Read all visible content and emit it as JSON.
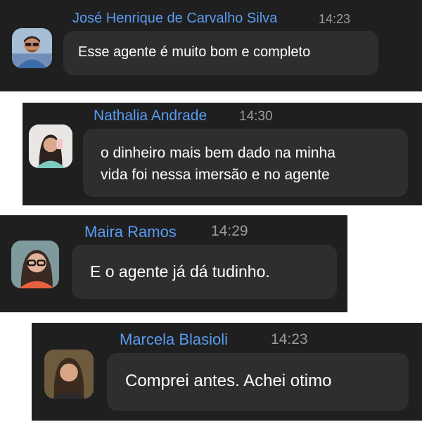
{
  "messages": [
    {
      "name": "José Henrique de Carvalho Silva",
      "time": "14:23",
      "text": "Esse agente é muito bom e completo"
    },
    {
      "name": "Nathalia Andrade",
      "time": "14:30",
      "text": "o dinheiro mais bem dado na minha\nvida foi nessa imersão e no agente"
    },
    {
      "name": "Maira Ramos",
      "time": "14:29",
      "text": "E o agente já dá tudinho."
    },
    {
      "name": "Marcela Blasioli",
      "time": "14:23",
      "text": "Comprei antes.  Achei otimo"
    }
  ],
  "colors": {
    "card_background": "#1f1f20",
    "bubble_background": "#2e2e30",
    "name_color": "#5a9bf0",
    "time_color": "#9b9b9b",
    "text_color": "#ffffff"
  }
}
